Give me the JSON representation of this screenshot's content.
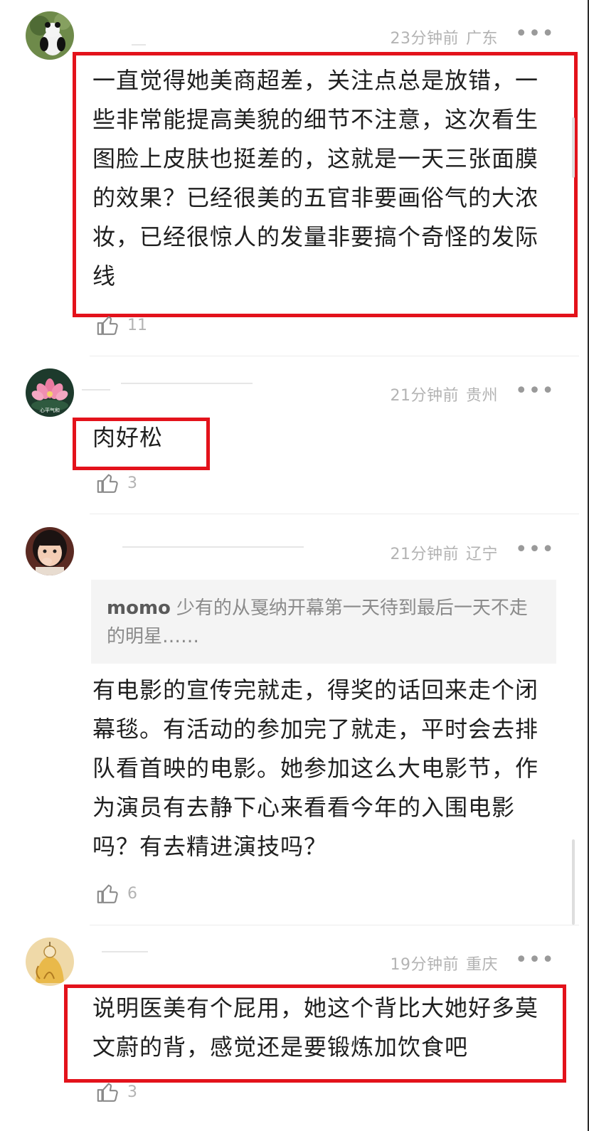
{
  "comments": [
    {
      "time": "23分钟前",
      "location": "广东",
      "text": "一直觉得她美商超差，关注点总是放错，一些非常能提高美貌的细节不注意，这次看生图脸上皮肤也挺差的，这就是一天三张面膜的效果？已经很美的五官非要画俗气的大浓妆，已经很惊人的发量非要搞个奇怪的发际线",
      "likes": "11",
      "avatar": "panda-avatar"
    },
    {
      "time": "21分钟前",
      "location": "贵州",
      "text": "肉好松",
      "likes": "3",
      "avatar": "lotus-avatar",
      "avatar_caption": "心平气和"
    },
    {
      "time": "21分钟前",
      "location": "辽宁",
      "quote_name": "momo",
      "quote_text": "少有的从戛纳开幕第一天待到最后一天不走的明星……",
      "text": "有电影的宣传完就走，得奖的话回来走个闭幕毯。有活动的参加完了就走，平时会去排队看首映的电影。她参加这么大电影节，作为演员有去静下心来看看今年的入围电影吗？有去精进演技吗？",
      "likes": "6",
      "avatar": "child-avatar"
    },
    {
      "time": "19分钟前",
      "location": "重庆",
      "text": "说明医美有个屁用，她这个背比大她好多莫文蔚的背，感觉还是要锻炼加饮食吧",
      "likes": "3",
      "avatar": "monk-avatar"
    }
  ],
  "icons": {
    "more": "more-dots-icon",
    "like": "thumb-up-icon"
  },
  "colors": {
    "highlight_box": "#e3121b",
    "meta_text": "#b3b3b3",
    "quote_bg": "#f4f4f4"
  },
  "more_glyph": "•••"
}
